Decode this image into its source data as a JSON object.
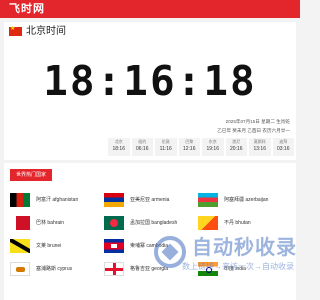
{
  "header": {
    "logo": "飞时网"
  },
  "main": {
    "title": "北京时间",
    "time": "18:16:18",
    "date": "2025年07月15日 星期二 生肖蛇",
    "lunar": "乙巳年 癸未月 乙酉日 农历六月廿一"
  },
  "cities": [
    {
      "name": "北京",
      "time": "18:16"
    },
    {
      "name": "纽约",
      "time": "06:16"
    },
    {
      "name": "伦敦",
      "time": "11:16"
    },
    {
      "name": "巴黎",
      "time": "12:16"
    },
    {
      "name": "东京",
      "time": "19:16"
    },
    {
      "name": "悉尼",
      "time": "20:16"
    },
    {
      "name": "莫斯科",
      "time": "13:16"
    },
    {
      "name": "迪拜",
      "time": "03:16"
    }
  ],
  "world": {
    "title": "世界热门国家",
    "countries": [
      {
        "label": "阿富汗 afghanistan",
        "flag": "afghanistan-flag-icon"
      },
      {
        "label": "亚美尼亚 armenia",
        "flag": "armenia-flag-icon"
      },
      {
        "label": "阿塞拜疆 azerbaijan",
        "flag": "azerbaijan-flag-icon"
      },
      {
        "label": "巴林 bahrain",
        "flag": "bahrain-flag-icon"
      },
      {
        "label": "孟加拉国 bangladesh",
        "flag": "bangladesh-flag-icon"
      },
      {
        "label": "不丹 bhutan",
        "flag": "bhutan-flag-icon"
      },
      {
        "label": "文莱 brunei",
        "flag": "brunei-flag-icon"
      },
      {
        "label": "柬埔寨 cambodia",
        "flag": "cambodia-flag-icon"
      },
      {
        "label": "",
        "flag": ""
      },
      {
        "label": "塞浦路斯 cyprus",
        "flag": "cyprus-flag-icon"
      },
      {
        "label": "格鲁吉亚 georgia",
        "flag": "georgia-flag-icon"
      },
      {
        "label": "印度 india",
        "flag": "india-flag-icon"
      }
    ]
  },
  "watermark": {
    "main": "自动秒收录",
    "sub": "数上链接→来访一次→自动收录"
  },
  "colors": {
    "accent": "#e3262c",
    "background": "#f3f3f3"
  }
}
